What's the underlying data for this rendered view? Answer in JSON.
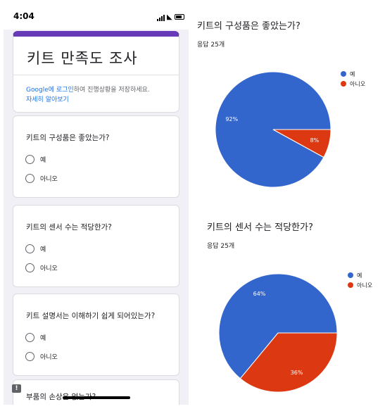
{
  "status_bar": {
    "time": "4:04"
  },
  "form": {
    "title": "키트 만족도 조사",
    "signin_link": "Google에 로그인",
    "signin_rest": "하여 진행상황을 저장하세요.",
    "learn_more": "자세히 알아보기",
    "questions": [
      {
        "title": "키트의 구성품은 좋았는가?",
        "options": [
          "예",
          "아니오"
        ]
      },
      {
        "title": "키트의 센서 수는 적당한가?",
        "options": [
          "예",
          "아니오"
        ]
      },
      {
        "title": "키트 설명서는 이해하기 쉽게 되어있는가?",
        "options": [
          "예",
          "아니오"
        ]
      },
      {
        "title": "부품의 손상은 없는가?"
      }
    ],
    "feedback_icon": "!"
  },
  "results": [
    {
      "title": "키트의 구성품은 좋았는가?",
      "responses": "응답 25개"
    },
    {
      "title": "키트의 센서 수는 적당한가?",
      "responses": "응답 25개"
    }
  ],
  "colors": {
    "yes": "#3366cc",
    "no": "#dc3912",
    "accent": "#673ab7",
    "link": "#1a73e8"
  },
  "chart_data": [
    {
      "type": "pie",
      "title": "키트의 구성품은 좋았는가?",
      "categories": [
        "예",
        "아니오"
      ],
      "values": [
        92,
        8
      ],
      "labels": [
        "92%",
        "8%"
      ],
      "legend": "right"
    },
    {
      "type": "pie",
      "title": "키트의 센서 수는 적당한가?",
      "categories": [
        "예",
        "아니오"
      ],
      "values": [
        64,
        36
      ],
      "labels": [
        "64%",
        "36%"
      ],
      "legend": "right"
    }
  ]
}
